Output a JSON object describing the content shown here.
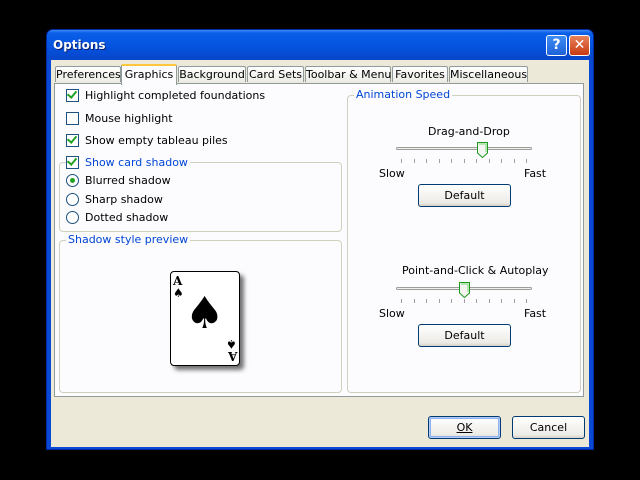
{
  "window": {
    "title": "Options",
    "help_glyph": "?",
    "close_glyph": "✕",
    "titlebar_color": "#0553e0",
    "accent_color": "#0046d5"
  },
  "tabs": [
    {
      "label": "Preferences",
      "active": false
    },
    {
      "label": "Graphics",
      "active": true
    },
    {
      "label": "Background",
      "active": false
    },
    {
      "label": "Card Sets",
      "active": false
    },
    {
      "label": "Toolbar & Menu",
      "active": false
    },
    {
      "label": "Favorites",
      "active": false
    },
    {
      "label": "Miscellaneous",
      "active": false
    }
  ],
  "graphics": {
    "highlight_foundations": {
      "label": "Highlight completed foundations",
      "checked": true
    },
    "mouse_highlight": {
      "label": "Mouse highlight",
      "checked": false
    },
    "show_empty_piles": {
      "label": "Show empty tableau piles",
      "checked": true
    },
    "card_shadow": {
      "label": "Show card shadow",
      "checked": true,
      "options": [
        {
          "label": "Blurred shadow",
          "selected": true
        },
        {
          "label": "Sharp shadow",
          "selected": false
        },
        {
          "label": "Dotted shadow",
          "selected": false
        }
      ]
    },
    "preview": {
      "label": "Shadow style preview",
      "card_rank": "A",
      "card_suit_glyph": "♠"
    }
  },
  "animation": {
    "title": "Animation Speed",
    "drag_drop": {
      "label": "Drag-and-Drop",
      "slow_label": "Slow",
      "fast_label": "Fast",
      "value_fraction": 0.65,
      "default_label": "Default"
    },
    "point_click": {
      "label": "Point-and-Click & Autoplay",
      "slow_label": "Slow",
      "fast_label": "Fast",
      "value_fraction": 0.5,
      "default_label": "Default"
    }
  },
  "buttons": {
    "ok_label": "OK",
    "cancel_label": "Cancel"
  }
}
